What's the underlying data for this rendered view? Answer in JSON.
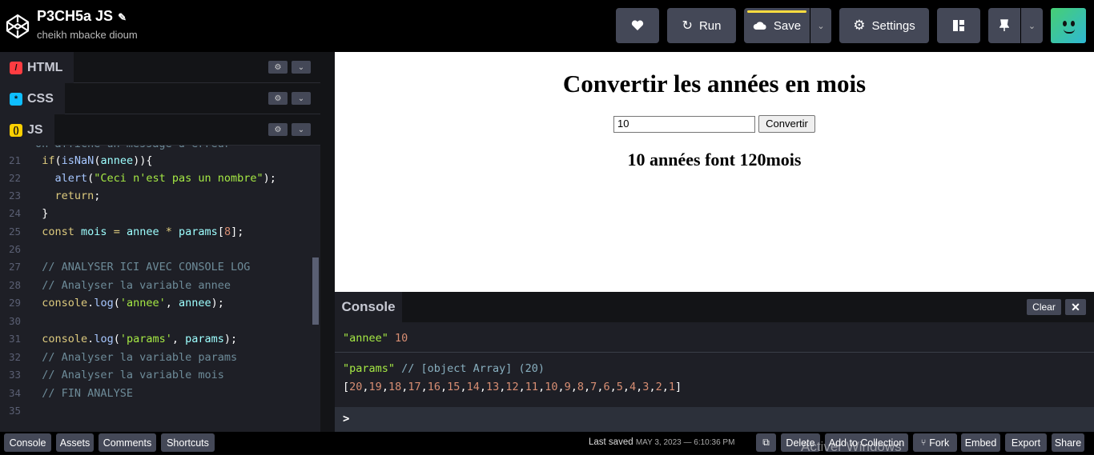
{
  "header": {
    "title": "P3CH5a JS",
    "author": "cheikh mbacke dioum",
    "run_label": "Run",
    "save_label": "Save",
    "settings_label": "Settings"
  },
  "editor": {
    "html_label": "HTML",
    "css_label": "CSS",
    "js_label": "JS",
    "partial_line": "on affiche un message d'erreur",
    "line_numbers": [
      "21",
      "22",
      "23",
      "24",
      "25",
      "26",
      "27",
      "28",
      "29",
      "30",
      "31",
      "32",
      "33",
      "34",
      "35"
    ]
  },
  "preview": {
    "heading": "Convertir les années en mois",
    "input_value": "10",
    "button_label": "Convertir",
    "result": "10 années font 120mois"
  },
  "console": {
    "tab_label": "Console",
    "clear_label": "Clear",
    "entry1_key": "\"annee\"",
    "entry1_value": "10",
    "entry2_key": "\"params\"",
    "entry2_comment": "// [object Array] (20)",
    "entry2_array": [
      20,
      19,
      18,
      17,
      16,
      15,
      14,
      13,
      12,
      11,
      10,
      9,
      8,
      7,
      6,
      5,
      4,
      3,
      2,
      1
    ],
    "prompt": ">"
  },
  "footer": {
    "console": "Console",
    "assets": "Assets",
    "comments": "Comments",
    "shortcuts": "Shortcuts",
    "last_saved_label": "Last saved",
    "last_saved_date": "MAY 3, 2023 — 6:10:36 PM",
    "delete": "Delete",
    "add_to_collection": "Add to Collection",
    "fork": "Fork",
    "embed": "Embed",
    "export": "Export",
    "share": "Share",
    "watermark": "Activer Windows"
  },
  "colors": {
    "accent_yellow": "#ffdd40",
    "html_badge": "#ff3c41",
    "css_badge": "#0ebeff",
    "js_badge": "#fcd000",
    "number": "#d88e73"
  }
}
